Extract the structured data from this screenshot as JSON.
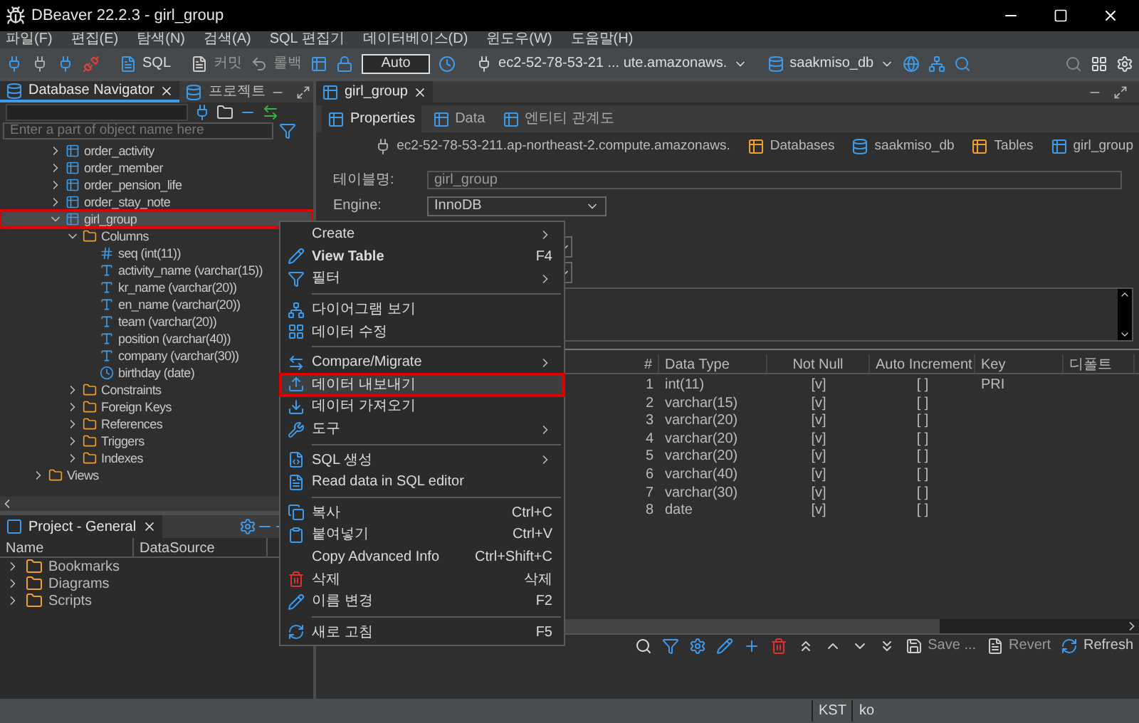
{
  "window": {
    "title": "DBeaver 22.2.3 - girl_group"
  },
  "menu_bar": [
    "파일(F)",
    "편집(E)",
    "탐색(N)",
    "검색(A)",
    "SQL 편집기",
    "데이터베이스(D)",
    "윈도우(W)",
    "도움말(H)"
  ],
  "toolbar": {
    "sql": "SQL",
    "commit": "커밋",
    "rollback": "롤백",
    "transaction_mode": "Auto",
    "connection": "ec2-52-78-53-21 ... ute.amazonaws.",
    "database": "saakmiso_db"
  },
  "navigator": {
    "tabs": [
      {
        "label": "Database Navigator",
        "selected": true
      },
      {
        "label": "프로젝트",
        "selected": false
      }
    ],
    "filter": {
      "placeholder": "Enter a part of object name here"
    },
    "tree": [
      {
        "kind": "scrolled",
        "children": [
          {
            "label": "order_activity",
            "kind": "table",
            "expanded": false,
            "selected": false
          },
          {
            "label": "order_member",
            "kind": "table",
            "expanded": false,
            "selected": false
          },
          {
            "label": "order_pension_life",
            "kind": "table",
            "expanded": false,
            "selected": false
          },
          {
            "label": "order_stay_note",
            "kind": "table",
            "expanded": false,
            "selected": false
          },
          {
            "label": "girl_group",
            "kind": "table",
            "expanded": true,
            "selected": true,
            "children": [
              {
                "label": "Columns",
                "kind": "folder",
                "expanded": true,
                "selected": false,
                "children": [
                  {
                    "label": "seq (int(11))",
                    "kind": "number",
                    "selected": false
                  },
                  {
                    "label": "activity_name (varchar(15))",
                    "kind": "text",
                    "selected": false
                  },
                  {
                    "label": "kr_name (varchar(20))",
                    "kind": "text",
                    "selected": false
                  },
                  {
                    "label": "en_name (varchar(20))",
                    "kind": "text",
                    "selected": false
                  },
                  {
                    "label": "team (varchar(20))",
                    "kind": "text",
                    "selected": false
                  },
                  {
                    "label": "position (varchar(40))",
                    "kind": "text",
                    "selected": false
                  },
                  {
                    "label": "company (varchar(30))",
                    "kind": "text",
                    "selected": false
                  },
                  {
                    "label": "birthday (date)",
                    "kind": "date",
                    "selected": false
                  }
                ]
              },
              {
                "label": "Constraints",
                "kind": "folder",
                "expanded": false,
                "selected": false
              },
              {
                "label": "Foreign Keys",
                "kind": "folder",
                "expanded": false,
                "selected": false
              },
              {
                "label": "References",
                "kind": "folder",
                "expanded": false,
                "selected": false
              },
              {
                "label": "Triggers",
                "kind": "folder",
                "expanded": false,
                "selected": false
              },
              {
                "label": "Indexes",
                "kind": "folder",
                "expanded": false,
                "selected": false
              }
            ]
          }
        ]
      },
      {
        "label": "Views",
        "kind": "folder",
        "expanded": false,
        "selected": false
      }
    ]
  },
  "project": {
    "title": "Project - General",
    "columns": [
      "Name",
      "DataSource"
    ],
    "items": [
      "Bookmarks",
      "Diagrams",
      "Scripts"
    ]
  },
  "editor": {
    "tab": "girl_group",
    "subtabs": [
      {
        "label": "Properties",
        "selected": true
      },
      {
        "label": "Data",
        "selected": false
      },
      {
        "label": "엔티티 관계도",
        "selected": false
      }
    ],
    "breadcrumb": [
      "ec2-52-78-53-211.ap-northeast-2.compute.amazonaws.",
      "Databases",
      "saakmiso_db",
      "Tables",
      "girl_group"
    ],
    "table_name": {
      "label": "테이블명:",
      "value": "girl_group"
    },
    "engine": {
      "label": "Engine:",
      "value": "InnoDB"
    },
    "columns_table": {
      "columns": [
        "#",
        "Data Type",
        "Not Null",
        "Auto Increment",
        "Key",
        "디폴트"
      ],
      "rows": [
        [
          "1",
          "int(11)",
          "[v]",
          "[ ]",
          "PRI"
        ],
        [
          "2",
          "varchar(15)",
          "[v]",
          "[ ]",
          ""
        ],
        [
          "3",
          "varchar(20)",
          "[v]",
          "[ ]",
          ""
        ],
        [
          "4",
          "varchar(20)",
          "[v]",
          "[ ]",
          ""
        ],
        [
          "5",
          "varchar(20)",
          "[v]",
          "[ ]",
          ""
        ],
        [
          "6",
          "varchar(40)",
          "[v]",
          "[ ]",
          ""
        ],
        [
          "7",
          "varchar(30)",
          "[v]",
          "[ ]",
          ""
        ],
        [
          "8",
          "date",
          "[v]",
          "[ ]",
          ""
        ]
      ]
    },
    "bottom_actions": [
      "Save ...",
      "Revert",
      "Refresh"
    ]
  },
  "context_menu": [
    {
      "kind": "item",
      "label": "Create",
      "submenu": true,
      "selected": false
    },
    {
      "kind": "item",
      "label": "View Table",
      "shortcut": "F4",
      "bold": true,
      "selected": false
    },
    {
      "kind": "item",
      "label": "필터",
      "submenu": true,
      "selected": false
    },
    {
      "kind": "separator"
    },
    {
      "kind": "item",
      "label": "다이어그램 보기",
      "selected": false
    },
    {
      "kind": "item",
      "label": "데이터 수정",
      "selected": false
    },
    {
      "kind": "separator"
    },
    {
      "kind": "item",
      "label": "Compare/Migrate",
      "submenu": true,
      "selected": false
    },
    {
      "kind": "item",
      "label": "데이터 내보내기",
      "selected": true
    },
    {
      "kind": "item",
      "label": "데이터 가져오기",
      "selected": false
    },
    {
      "kind": "item",
      "label": "도구",
      "submenu": true,
      "selected": false
    },
    {
      "kind": "separator"
    },
    {
      "kind": "item",
      "label": "SQL 생성",
      "submenu": true,
      "selected": false
    },
    {
      "kind": "item",
      "label": "Read data in SQL editor",
      "selected": false
    },
    {
      "kind": "separator"
    },
    {
      "kind": "item",
      "label": "복사",
      "shortcut": "Ctrl+C",
      "selected": false
    },
    {
      "kind": "item",
      "label": "붙여넣기",
      "shortcut": "Ctrl+V",
      "selected": false
    },
    {
      "kind": "item",
      "label": "Copy Advanced Info",
      "shortcut": "Ctrl+Shift+C",
      "selected": false
    },
    {
      "kind": "item",
      "label": "삭제",
      "shortcut": "삭제",
      "selected": false
    },
    {
      "kind": "item",
      "label": "이름 변경",
      "shortcut": "F2",
      "selected": false
    },
    {
      "kind": "separator"
    },
    {
      "kind": "item",
      "label": "새로 고침",
      "shortcut": "F5",
      "selected": false
    }
  ],
  "status_bar": [
    "KST",
    "ko"
  ]
}
